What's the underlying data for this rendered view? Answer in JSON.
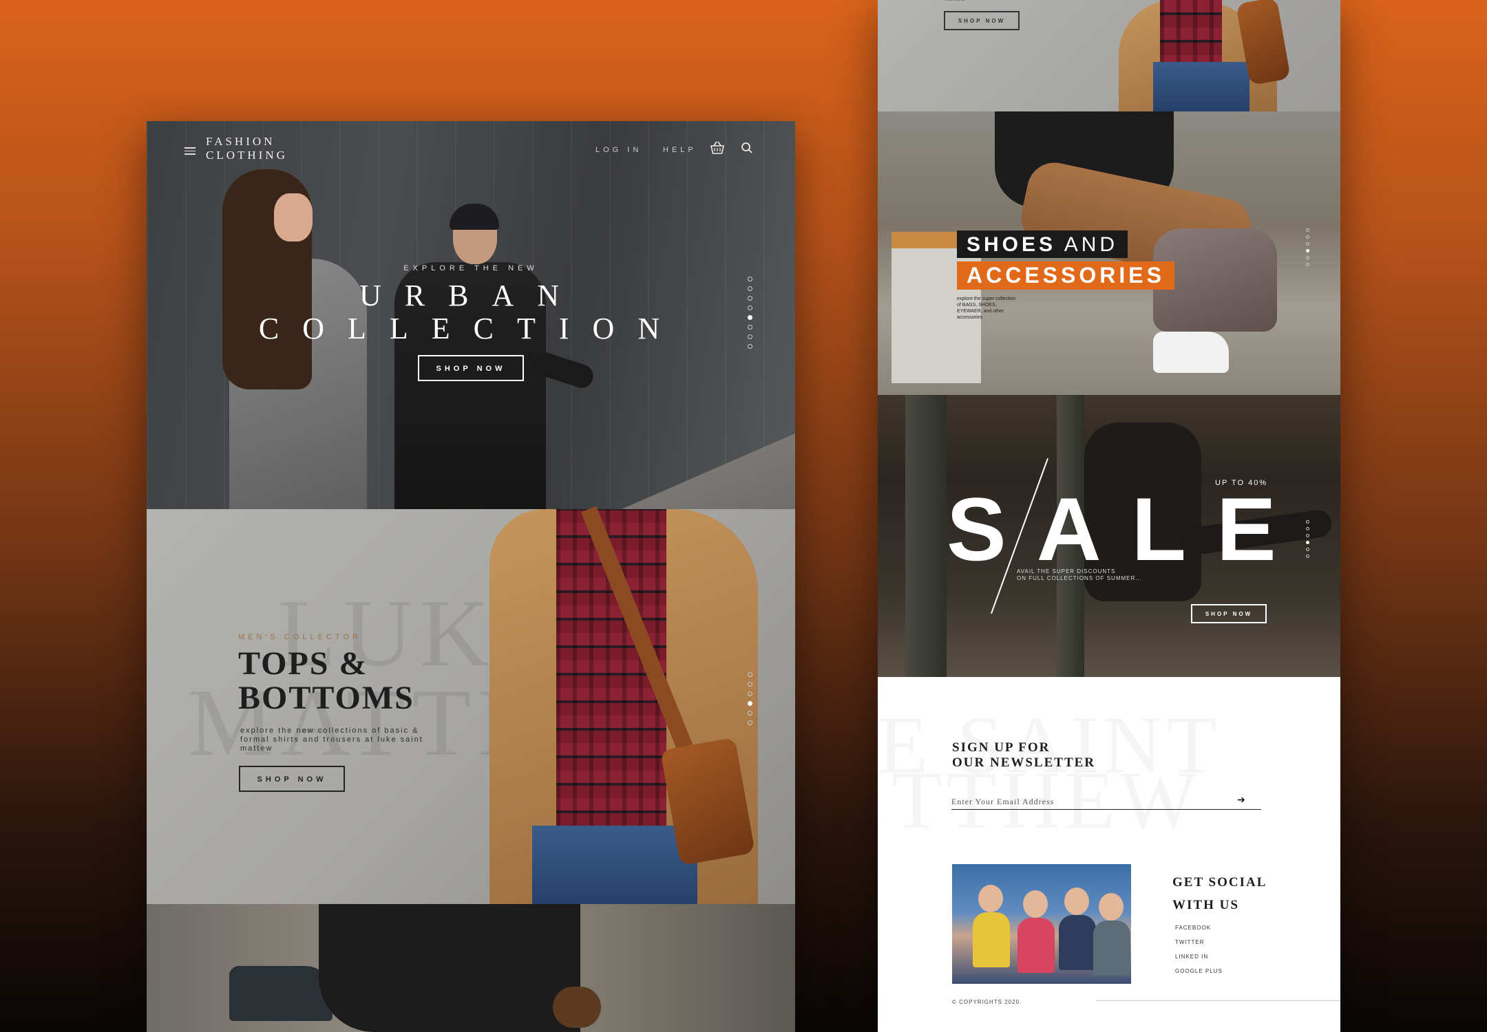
{
  "header": {
    "brand_line1": "FASHION",
    "brand_line2": "CLOTHING",
    "login_label": "LOG IN",
    "help_label": "HELP",
    "icons": [
      "menu-icon",
      "basket-icon",
      "search-icon"
    ]
  },
  "hero": {
    "kicker": "EXPLORE THE NEW",
    "title_line1": "URBAN",
    "title_line2": "COLLECTION",
    "cta": "SHOP NOW"
  },
  "tops": {
    "ghost_line1": "LUKE",
    "ghost_line2": "MATTEW",
    "kicker": "MEN'S COLLECTOR",
    "title_line1": "TOPS &",
    "title_line2": "BOTTOMS",
    "body": "explore the new collections of basic & formal shirts and trousers at luke saint mattew",
    "cta": "SHOP NOW"
  },
  "right_top": {
    "caption": "mattew",
    "cta": "SHOP NOW"
  },
  "shoes": {
    "title_part1": "SHOES",
    "title_part2": "AND",
    "title_line2": "ACCESSORIES",
    "body": "explore the super collection of BAGS, SHOES, EYEWAER, and other accessories"
  },
  "sale": {
    "kicker": "UP TO 40%",
    "title": "SALE",
    "body_line1": "AVAIL THE SUPER DISCOUNTS",
    "body_line2": "ON FULL COLLECTIONS OF SUMMER...",
    "cta": "SHOP NOW"
  },
  "newsletter": {
    "ghost_line1": "E SAINT",
    "ghost_line2": "TTHEW",
    "title_line1": "SIGN UP FOR",
    "title_line2": "OUR NEWSLETTER",
    "email_placeholder": "Enter Your Email Address"
  },
  "social": {
    "title_line1": "GET SOCIAL",
    "title_line2": "WITH US",
    "links": [
      "FACEBOOK",
      "TWITTER",
      "LINKED IN",
      "GOOGLE PLUS"
    ]
  },
  "footer": {
    "copyright": "© COPYRIGHTS 2020."
  },
  "colors": {
    "accent_orange": "#e06a1a",
    "background_top": "#d9621a",
    "background_bottom": "#0a0605"
  }
}
